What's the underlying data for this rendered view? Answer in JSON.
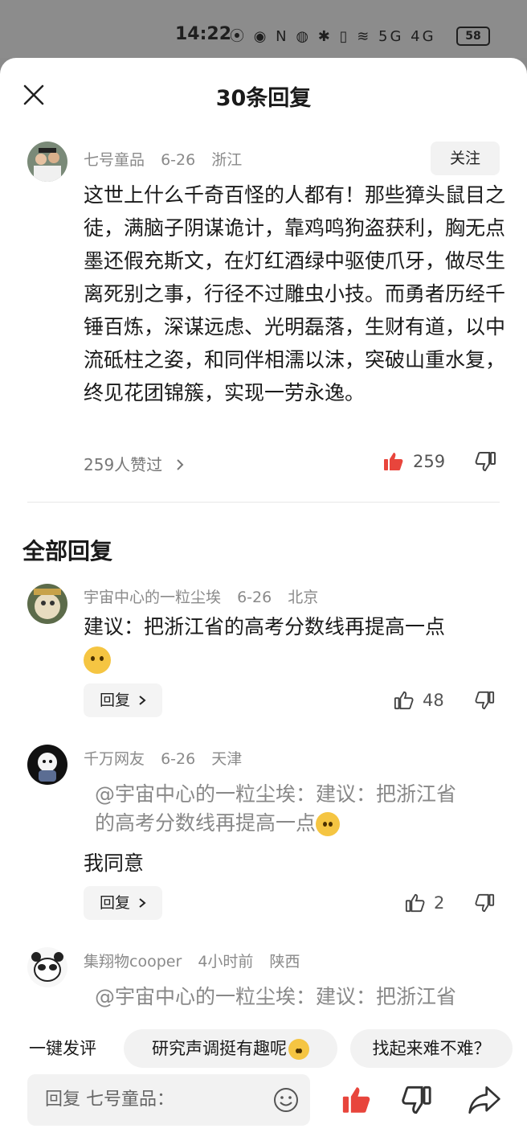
{
  "status_bar": {
    "time": "14:22",
    "icons_text": "⦿ ◉ N ◍ ✱ ▯ ≋ 5G 4G",
    "battery": "58"
  },
  "sheet": {
    "title": "30条回复"
  },
  "main_comment": {
    "user": "七号童品",
    "date": "6-26",
    "location": "浙江",
    "follow_label": "关注",
    "text": "这世上什么千奇百怪的人都有！那些獐头鼠目之徒，满脑子阴谋诡计，靠鸡鸣狗盗获利，胸无点墨还假充斯文，在灯红酒绿中驱使爪牙，做尽生离死别之事，行径不过雕虫小技。而勇者历经千锤百炼，深谋远虑、光明磊落，生财有道，以中流砥柱之姿，和同伴相濡以沫，突破山重水复，终见花团锦簇，实现一劳永逸。",
    "likes_by": "259人赞过",
    "like_count": "259",
    "like_color": "#e8453c"
  },
  "section_title": "全部回复",
  "replies": [
    {
      "user": "宇宙中心的一粒尘埃",
      "date": "6-26",
      "location": "北京",
      "text": "建议：把浙江省的高考分数线再提高一点",
      "reply_label": "回复",
      "like_count": "48"
    },
    {
      "user": "千万网友",
      "date": "6-26",
      "location": "天津",
      "quote_line1": "@宇宙中心的一粒尘埃：建议：把浙江省",
      "quote_line2": "的高考分数线再提高一点",
      "text": "我同意",
      "reply_label": "回复",
      "like_count": "2"
    },
    {
      "user": "集翔物cooper",
      "date": "4小时前",
      "location": "陕西",
      "quote_line1": "@宇宙中心的一粒尘埃：建议：把浙江省"
    }
  ],
  "bottom": {
    "quick_label": "一键发评",
    "chips": [
      "研究声调挺有趣呢",
      "找起来难不难？"
    ],
    "input_placeholder": "回复 七号童品：",
    "accent": "#e8453c"
  }
}
